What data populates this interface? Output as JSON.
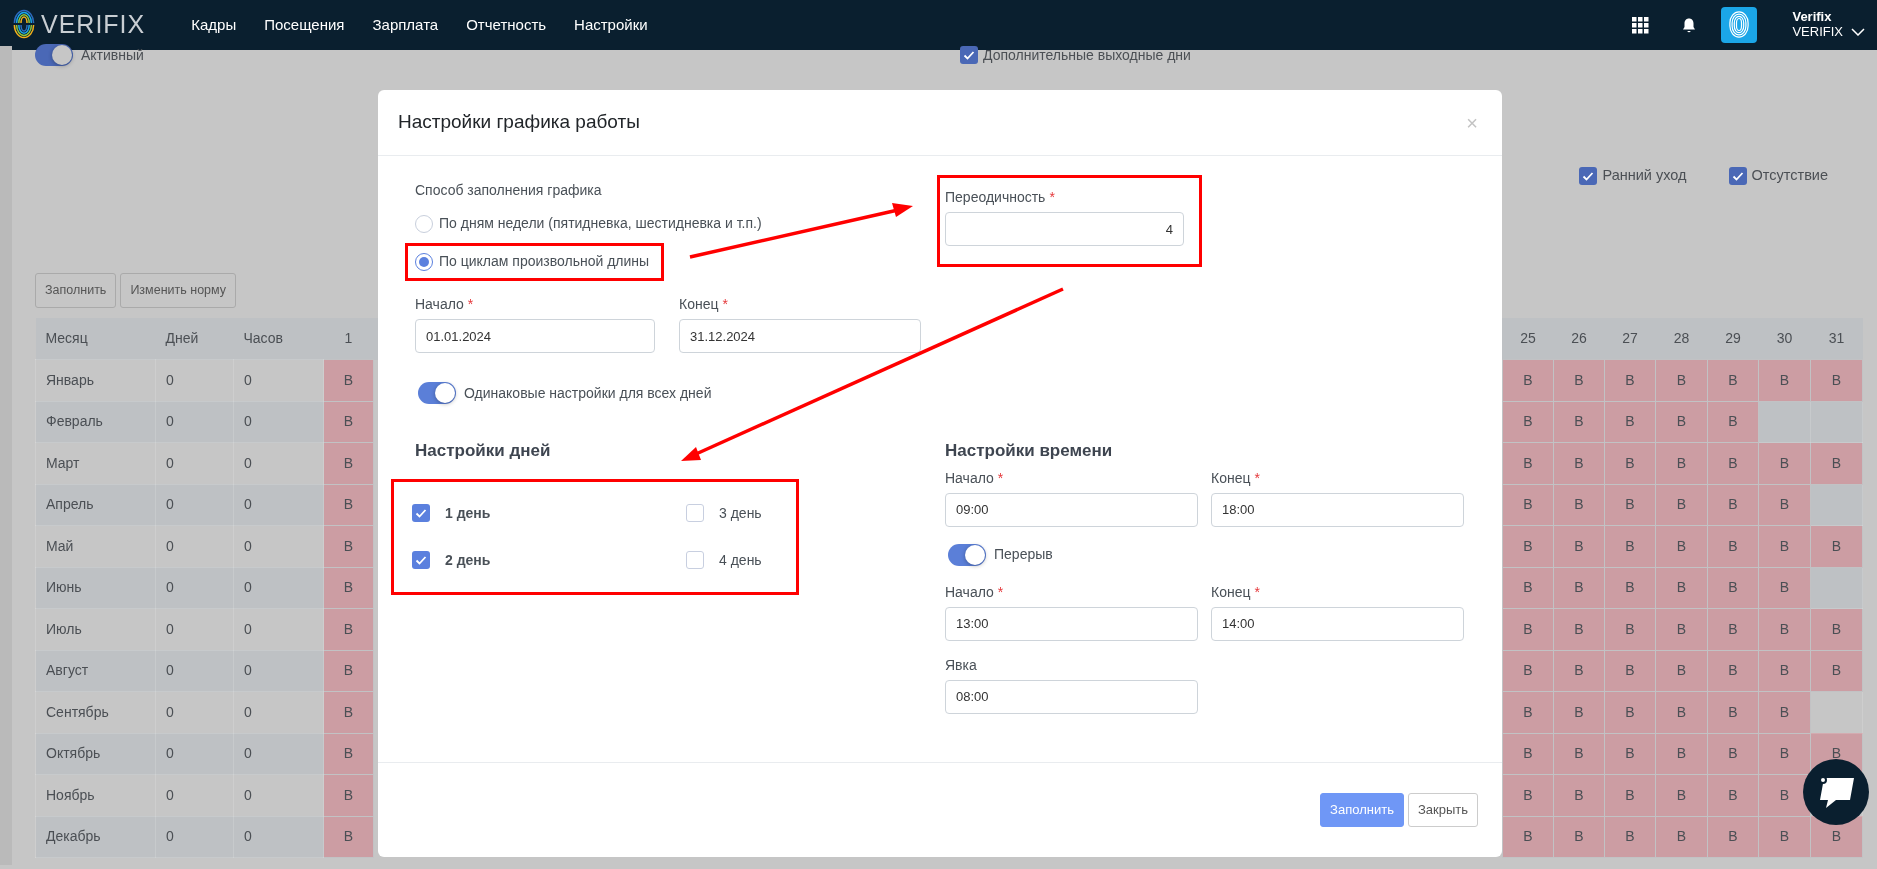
{
  "navbar": {
    "logo_text": "VERIFIX",
    "menu": [
      "Кадры",
      "Посещения",
      "Зарплата",
      "Отчетность",
      "Настройки"
    ],
    "user": {
      "name": "Verifix",
      "company": "VERIFIX"
    }
  },
  "page": {
    "active_toggle": {
      "label": "Активный",
      "on": true
    },
    "filters": [
      {
        "label": "Дополнительные выходные дни",
        "checked": true
      },
      {
        "label": "Ранний уход",
        "checked": true
      },
      {
        "label": "Отсутствие",
        "checked": true
      }
    ],
    "buttons": [
      "Заполнить",
      "Изменить норму"
    ],
    "table": {
      "columns": [
        "Месяц",
        "Дней",
        "Часов",
        "1",
        "25",
        "26",
        "27",
        "28",
        "29",
        "30",
        "31"
      ],
      "rows": [
        {
          "month": "Январь",
          "days": "0",
          "hours": "0",
          "day_cells": [
            "В",
            "В",
            "В",
            "В",
            "В",
            "В",
            "В",
            "В"
          ]
        },
        {
          "month": "Февраль",
          "days": "0",
          "hours": "0",
          "day_cells": [
            "В",
            "В",
            "В",
            "В",
            "В",
            "В"
          ]
        },
        {
          "month": "Март",
          "days": "0",
          "hours": "0",
          "day_cells": [
            "В",
            "В",
            "В",
            "В",
            "В",
            "В",
            "В",
            "В"
          ]
        },
        {
          "month": "Апрель",
          "days": "0",
          "hours": "0",
          "day_cells": [
            "В",
            "В",
            "В",
            "В",
            "В",
            "В",
            "В"
          ]
        },
        {
          "month": "Май",
          "days": "0",
          "hours": "0",
          "day_cells": [
            "В",
            "В",
            "В",
            "В",
            "В",
            "В",
            "В",
            "В"
          ]
        },
        {
          "month": "Июнь",
          "days": "0",
          "hours": "0",
          "day_cells": [
            "В",
            "В",
            "В",
            "В",
            "В",
            "В",
            "В"
          ]
        },
        {
          "month": "Июль",
          "days": "0",
          "hours": "0",
          "day_cells": [
            "В",
            "В",
            "В",
            "В",
            "В",
            "В",
            "В",
            "В"
          ]
        },
        {
          "month": "Август",
          "days": "0",
          "hours": "0",
          "day_cells": [
            "В",
            "В",
            "В",
            "В",
            "В",
            "В",
            "В",
            "В"
          ]
        },
        {
          "month": "Сентябрь",
          "days": "0",
          "hours": "0",
          "day_cells": [
            "В",
            "В",
            "В",
            "В",
            "В",
            "В",
            "В"
          ]
        },
        {
          "month": "Октябрь",
          "days": "0",
          "hours": "0",
          "day_cells": [
            "В",
            "В",
            "В",
            "В",
            "В",
            "В",
            "В",
            "В"
          ]
        },
        {
          "month": "Ноябрь",
          "days": "0",
          "hours": "0",
          "day_cells": [
            "В",
            "В",
            "В",
            "В",
            "В",
            "В",
            "В"
          ]
        },
        {
          "month": "Декабрь",
          "days": "0",
          "hours": "0",
          "day_cells": [
            "В",
            "В",
            "В",
            "В",
            "В",
            "В",
            "В",
            "В"
          ]
        }
      ]
    }
  },
  "modal": {
    "title": "Настройки графика работы",
    "close": "×",
    "fill_method": {
      "label": "Способ заполнения графика",
      "options": [
        {
          "label": "По дням недели (пятидневка, шестидневка и т.п.)",
          "selected": false,
          "highlighted": false
        },
        {
          "label": "По циклам произвольной длины",
          "selected": true,
          "highlighted": true
        }
      ]
    },
    "periodicity": {
      "label": "Переодичность",
      "required_mark": "*",
      "value": "4",
      "highlighted": true
    },
    "period": [
      {
        "label": "Начало",
        "required_mark": "*",
        "value": "01.01.2024"
      },
      {
        "label": "Конец",
        "required_mark": "*",
        "value": "31.12.2024"
      }
    ],
    "same_settings": {
      "label": "Одинаковые настройки для всех дней",
      "on": true
    },
    "days_settings": {
      "title": "Настройки дней",
      "highlighted": true,
      "days": [
        {
          "label": "1 день",
          "checked": true
        },
        {
          "label": "2 день",
          "checked": true
        },
        {
          "label": "3 день",
          "checked": false
        },
        {
          "label": "4 день",
          "checked": false
        }
      ]
    },
    "time_settings": {
      "title": "Настройки времени",
      "work": [
        {
          "label": "Начало",
          "required_mark": "*",
          "value": "09:00"
        },
        {
          "label": "Конец",
          "required_mark": "*",
          "value": "18:00"
        }
      ],
      "break_toggle": {
        "label": "Перерыв",
        "on": true
      },
      "break": [
        {
          "label": "Начало",
          "required_mark": "*",
          "value": "13:00"
        },
        {
          "label": "Конец",
          "required_mark": "*",
          "value": "14:00"
        }
      ],
      "attendance": {
        "label": "Явка",
        "value": "08:00"
      }
    },
    "buttons": [
      {
        "label": "Заполнить",
        "kind": "primary"
      },
      {
        "label": "Закрыть",
        "kind": "secondary"
      }
    ]
  }
}
